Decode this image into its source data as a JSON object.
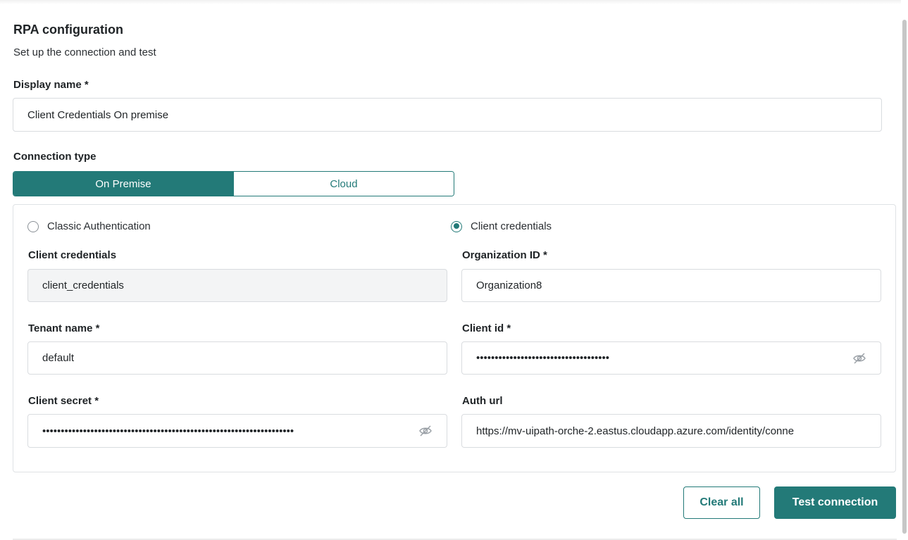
{
  "section": {
    "title": "RPA configuration",
    "subtitle": "Set up the connection and test"
  },
  "display_name": {
    "label": "Display name *",
    "value": "Client Credentials On premise"
  },
  "connection_type": {
    "label": "Connection type",
    "options": [
      "On Premise",
      "Cloud"
    ],
    "selected": "On Premise"
  },
  "auth": {
    "options": [
      "Classic Authentication",
      "Client credentials"
    ],
    "selected": "Client credentials"
  },
  "fields": {
    "client_credentials": {
      "label": "Client credentials",
      "value": "client_credentials"
    },
    "organization_id": {
      "label": "Organization ID *",
      "value": "Organization8"
    },
    "tenant_name": {
      "label": "Tenant name *",
      "value": "default"
    },
    "client_id": {
      "label": "Client id *",
      "value": "••••••••••••••••••••••••••••••••••••",
      "icon": "eye-off-icon"
    },
    "client_secret": {
      "label": "Client secret *",
      "value": "••••••••••••••••••••••••••••••••••••••••••••••••••••••••••••••••••••",
      "icon": "eye-off-icon"
    },
    "auth_url": {
      "label": "Auth url",
      "value": "https://mv-uipath-orche-2.eastus.cloudapp.azure.com/identity/conne"
    }
  },
  "actions": {
    "clear_all": "Clear all",
    "test_connection": "Test connection"
  },
  "colors": {
    "accent": "#237a78",
    "border": "#d9dcdf",
    "readonly_bg": "#f3f4f5"
  }
}
